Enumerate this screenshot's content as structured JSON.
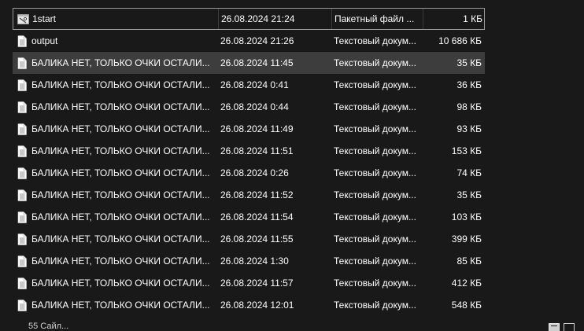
{
  "files": [
    {
      "name": "1start",
      "date": "26.08.2024 21:24",
      "type": "Пакетный файл ...",
      "size": "1 КБ",
      "icon": "batch-file-icon"
    },
    {
      "name": "output",
      "date": "26.08.2024 21:26",
      "type": "Текстовый докум...",
      "size": "10 686 КБ",
      "icon": "text-file-icon"
    },
    {
      "name": "БАЛИКА НЕТ, ТОЛЬКО ОЧКИ ОСТАЛИ...",
      "date": "26.08.2024 11:45",
      "type": "Текстовый докум...",
      "size": "35 КБ",
      "icon": "text-file-icon"
    },
    {
      "name": "БАЛИКА НЕТ, ТОЛЬКО ОЧКИ ОСТАЛИ...",
      "date": "26.08.2024 0:41",
      "type": "Текстовый докум...",
      "size": "36 КБ",
      "icon": "text-file-icon"
    },
    {
      "name": "БАЛИКА НЕТ, ТОЛЬКО ОЧКИ ОСТАЛИ...",
      "date": "26.08.2024 0:44",
      "type": "Текстовый докум...",
      "size": "98 КБ",
      "icon": "text-file-icon"
    },
    {
      "name": "БАЛИКА НЕТ, ТОЛЬКО ОЧКИ ОСТАЛИ...",
      "date": "26.08.2024 11:49",
      "type": "Текстовый докум...",
      "size": "93 КБ",
      "icon": "text-file-icon"
    },
    {
      "name": "БАЛИКА НЕТ, ТОЛЬКО ОЧКИ ОСТАЛИ...",
      "date": "26.08.2024 11:51",
      "type": "Текстовый докум...",
      "size": "153 КБ",
      "icon": "text-file-icon"
    },
    {
      "name": "БАЛИКА НЕТ, ТОЛЬКО ОЧКИ ОСТАЛИ...",
      "date": "26.08.2024 0:26",
      "type": "Текстовый докум...",
      "size": "74 КБ",
      "icon": "text-file-icon"
    },
    {
      "name": "БАЛИКА НЕТ, ТОЛЬКО ОЧКИ ОСТАЛИ...",
      "date": "26.08.2024 11:52",
      "type": "Текстовый докум...",
      "size": "35 КБ",
      "icon": "text-file-icon"
    },
    {
      "name": "БАЛИКА НЕТ, ТОЛЬКО ОЧКИ ОСТАЛИ...",
      "date": "26.08.2024 11:54",
      "type": "Текстовый докум...",
      "size": "103 КБ",
      "icon": "text-file-icon"
    },
    {
      "name": "БАЛИКА НЕТ, ТОЛЬКО ОЧКИ ОСТАЛИ...",
      "date": "26.08.2024 11:55",
      "type": "Текстовый докум...",
      "size": "399 КБ",
      "icon": "text-file-icon"
    },
    {
      "name": "БАЛИКА НЕТ, ТОЛЬКО ОЧКИ ОСТАЛИ...",
      "date": "26.08.2024 1:30",
      "type": "Текстовый докум...",
      "size": "85 КБ",
      "icon": "text-file-icon"
    },
    {
      "name": "БАЛИКА НЕТ, ТОЛЬКО ОЧКИ ОСТАЛИ...",
      "date": "26.08.2024 11:57",
      "type": "Текстовый докум...",
      "size": "412 КБ",
      "icon": "text-file-icon"
    },
    {
      "name": "БАЛИКА НЕТ, ТОЛЬКО ОЧКИ ОСТАЛИ...",
      "date": "26.08.2024 12:01",
      "type": "Текстовый докум...",
      "size": "548 КБ",
      "icon": "text-file-icon"
    }
  ],
  "row_states": [
    "focused",
    "normal",
    "selected",
    "normal",
    "normal",
    "normal",
    "normal",
    "normal",
    "normal",
    "normal",
    "normal",
    "normal",
    "normal",
    "normal"
  ],
  "statusbar": {
    "item_count": "55 Сайл..."
  },
  "colors": {
    "background": "#191919",
    "selected_row": "#3d3d3d",
    "focus_border": "#9a9a9a",
    "text": "#ffffff"
  }
}
